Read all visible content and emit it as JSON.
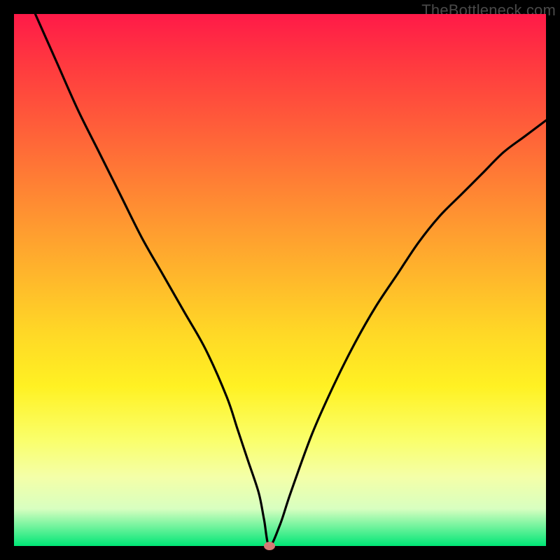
{
  "watermark": {
    "text": "TheBottleneck.com"
  },
  "chart_data": {
    "type": "line",
    "title": "",
    "xlabel": "",
    "ylabel": "",
    "xlim": [
      0,
      100
    ],
    "ylim": [
      0,
      100
    ],
    "grid": false,
    "legend": false,
    "series": [
      {
        "name": "curve",
        "x": [
          4,
          8,
          12,
          16,
          20,
          24,
          28,
          32,
          36,
          40,
          42,
          44,
          46,
          47,
          48,
          50,
          52,
          56,
          60,
          64,
          68,
          72,
          76,
          80,
          84,
          88,
          92,
          96,
          100
        ],
        "values": [
          100,
          91,
          82,
          74,
          66,
          58,
          51,
          44,
          37,
          28,
          22,
          16,
          10,
          5,
          0,
          4,
          10,
          21,
          30,
          38,
          45,
          51,
          57,
          62,
          66,
          70,
          74,
          77,
          80
        ]
      }
    ],
    "marker": {
      "x": 48,
      "y": 0,
      "color": "#d47a76"
    },
    "background_gradient": {
      "stops": [
        {
          "pos": 0.0,
          "color": "#ff1a48"
        },
        {
          "pos": 0.5,
          "color": "#ffb92b"
        },
        {
          "pos": 0.8,
          "color": "#faff6a"
        },
        {
          "pos": 1.0,
          "color": "#00e676"
        }
      ]
    }
  }
}
